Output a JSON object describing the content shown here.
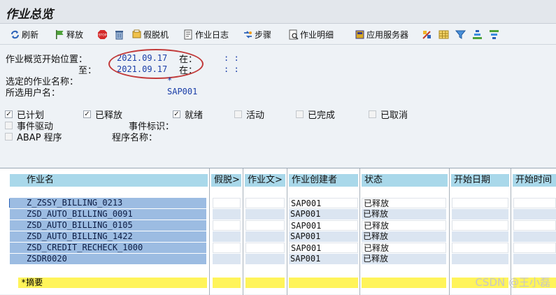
{
  "title": "作业总览",
  "toolbar": {
    "refresh": "刷新",
    "release": "释放",
    "deactivate": "假脱机",
    "job_log": "作业日志",
    "step": "步骤",
    "job_details": "作业明细",
    "app_server": "应用服务器"
  },
  "filters": {
    "start_label": "作业概览开始位置：",
    "start_date": "2021.09.17",
    "at_label": "在：",
    "start_time": ":  :",
    "to_label": "至：",
    "end_date": "2021.09.17",
    "end_time": ":  :",
    "job_name_label": "选定的作业名称：",
    "job_name_value": "*",
    "user_label": "所选用户名：",
    "user_value": "SAP001"
  },
  "status_filters": {
    "scheduled": {
      "label": "已计划",
      "checked": true
    },
    "released": {
      "label": "已释放",
      "checked": true
    },
    "ready": {
      "label": "就绪",
      "checked": true
    },
    "active": {
      "label": "活动",
      "checked": false
    },
    "finished": {
      "label": "已完成",
      "checked": false
    },
    "canceled": {
      "label": "已取消",
      "checked": false
    },
    "event_driven": "事件驱动",
    "event_id_label": "事件标识：",
    "abap_program": "ABAP 程序",
    "program_name_label": "程序名称："
  },
  "table": {
    "headers": [
      "作业名",
      "假脱>",
      "作业文>",
      "作业创建者",
      "状态",
      "开始日期",
      "开始时间"
    ],
    "rows": [
      {
        "name": "Z_ZSSY_BILLING_0213",
        "creator": "SAP001",
        "status": "已释放"
      },
      {
        "name": "ZSD_AUTO_BILLING_0091",
        "creator": "SAP001",
        "status": "已释放"
      },
      {
        "name": "ZSD_AUTO_BILLING_0105",
        "creator": "SAP001",
        "status": "已释放"
      },
      {
        "name": "ZSD_AUTO_BILLING_1422",
        "creator": "SAP001",
        "status": "已释放"
      },
      {
        "name": "ZSD_CREDIT_RECHECK_1000",
        "creator": "SAP001",
        "status": "已释放"
      },
      {
        "name": "ZSDR0020",
        "creator": "SAP001",
        "status": "已释放"
      }
    ],
    "summary": "*摘要"
  },
  "watermark": "CSDN @王小磊"
}
